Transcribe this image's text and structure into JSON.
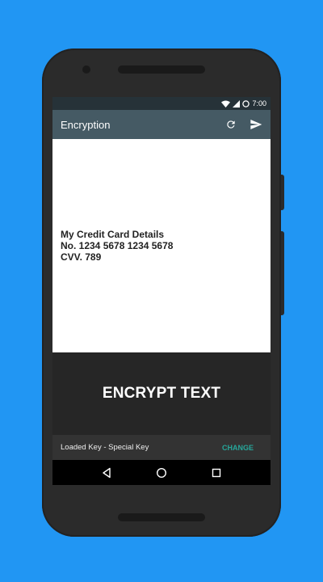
{
  "status_bar": {
    "time": "7:00",
    "icons": [
      "wifi-icon",
      "signal-icon",
      "battery-icon"
    ]
  },
  "app_bar": {
    "title": "Encryption",
    "actions": [
      "refresh-icon",
      "send-icon"
    ]
  },
  "text_content": {
    "lines": [
      "My Credit Card Details",
      "No. 1234 5678 1234 5678",
      "CVV. 789"
    ]
  },
  "encrypt_button": {
    "label": "ENCRYPT TEXT"
  },
  "key_bar": {
    "label": "Loaded Key - Special Key",
    "action_label": "CHANGE"
  },
  "nav_bar": {
    "buttons": [
      "back-icon",
      "home-icon",
      "recents-icon"
    ]
  },
  "colors": {
    "background": "#2196F3",
    "app_bar": "#455A64",
    "status_bar": "#263238",
    "accent": "#26A69A"
  }
}
